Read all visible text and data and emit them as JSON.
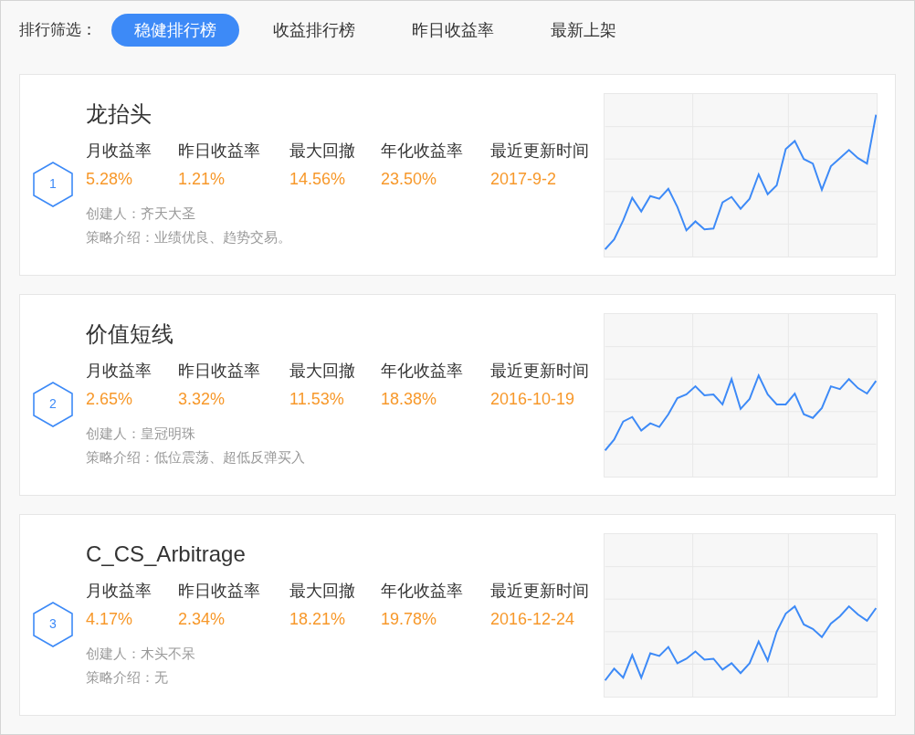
{
  "filter": {
    "label": "排行筛选：",
    "tabs": [
      {
        "label": "稳健排行榜",
        "selected": true
      },
      {
        "label": "收益排行榜",
        "selected": false
      },
      {
        "label": "昨日收益率",
        "selected": false
      },
      {
        "label": "最新上架",
        "selected": false
      }
    ]
  },
  "strategies": [
    {
      "rank": "1",
      "name": "龙抬头",
      "metrics": [
        {
          "label": "月收益率",
          "value": "5.28%"
        },
        {
          "label": "昨日收益率",
          "value": "1.21%"
        },
        {
          "label": "最大回撤",
          "value": "14.56%"
        },
        {
          "label": "年化收益率",
          "value": "23.50%"
        },
        {
          "label": "最近更新时间",
          "value": "2017-9-2"
        }
      ],
      "creator": "创建人：齐天大圣",
      "intro": "策略介绍：业绩优良、趋势交易。"
    },
    {
      "rank": "2",
      "name": "价值短线",
      "metrics": [
        {
          "label": "月收益率",
          "value": "2.65%"
        },
        {
          "label": "昨日收益率",
          "value": "3.32%"
        },
        {
          "label": "最大回撤",
          "value": "11.53%"
        },
        {
          "label": "年化收益率",
          "value": "18.38%"
        },
        {
          "label": "最近更新时间",
          "value": "2016-10-19"
        }
      ],
      "creator": "创建人：皇冠明珠",
      "intro": "策略介绍：低位震荡、超低反弹买入"
    },
    {
      "rank": "3",
      "name": "C_CS_Arbitrage",
      "metrics": [
        {
          "label": "月收益率",
          "value": "4.17%"
        },
        {
          "label": "昨日收益率",
          "value": "2.34%"
        },
        {
          "label": "最大回撤",
          "value": "18.21%"
        },
        {
          "label": "年化收益率",
          "value": "19.78%"
        },
        {
          "label": "最近更新时间",
          "value": "2016-12-24"
        }
      ],
      "creator": "创建人：木头不呆",
      "intro": "策略介绍：无"
    }
  ]
}
